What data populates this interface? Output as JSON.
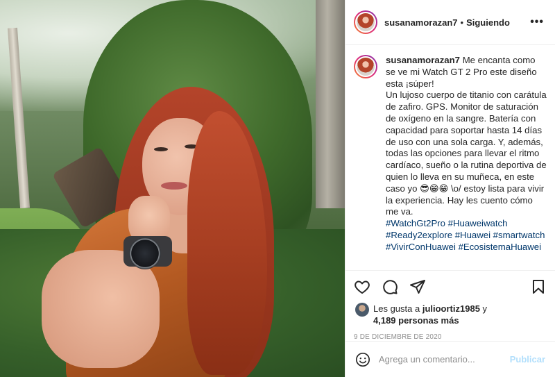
{
  "header": {
    "username": "susanamorazan7",
    "separator": "•",
    "follow_status": "Siguiendo",
    "more_label": "•••"
  },
  "caption": {
    "username": "susanamorazan7",
    "text": "Me encanta como se ve mi Watch GT 2 Pro este diseño esta ¡súper!\nUn lujoso cuerpo de titanio con carátula de zafiro. GPS. Monitor de saturación de oxígeno en la sangre. Batería con capacidad para soportar hasta 14 días de uso con una sola carga. Y, además, todas las opciones para llevar el ritmo cardíaco, sueño o la rutina deportiva de quien lo lleva en su muñeca, en este caso yo 😎😁😁 \\o/ estoy lista para vivir la experiencia. Hay les cuento cómo me va.",
    "hashtags": "#WatchGt2Pro #Huaweiwatch #Ready2explore #Huawei #smartwatch #VivirConHuawei #EcosistemaHuawei"
  },
  "icons": {
    "like": "heart-icon",
    "comment": "comment-icon",
    "share": "paper-plane-icon",
    "save": "bookmark-icon",
    "emoji": "smiley-icon"
  },
  "likes": {
    "prefix": "Les gusta a",
    "user": "julioortiz1985",
    "conjunction": "y",
    "count": "4,189 personas más"
  },
  "date": "9 DE DICIEMBRE DE 2020",
  "comment": {
    "placeholder": "Agrega un comentario...",
    "publish_label": "Publicar"
  },
  "colors": {
    "link": "#00376b",
    "publish_disabled": "#b2dffc",
    "muted": "#8e8e8e"
  }
}
